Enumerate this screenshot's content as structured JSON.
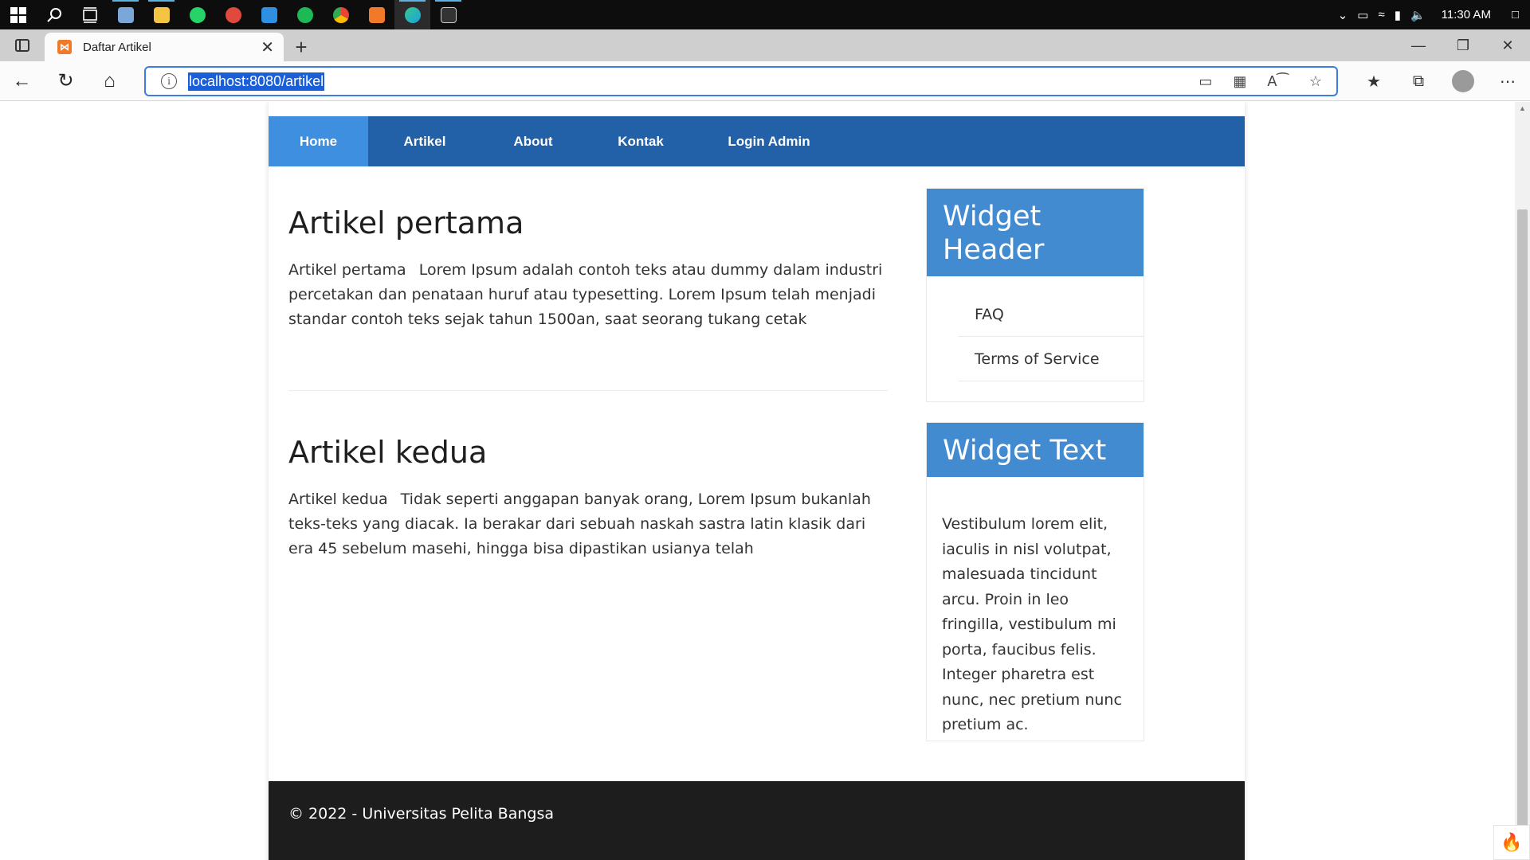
{
  "taskbar": {
    "apps": [
      {
        "name": "windows-start-icon",
        "color": "#ffffff",
        "active": false
      },
      {
        "name": "search-icon",
        "color": "#ffffff",
        "active": false
      },
      {
        "name": "task-view-icon",
        "color": "#ffffff",
        "active": false
      },
      {
        "name": "photos-app-icon",
        "color": "#7aa7d8",
        "active": true
      },
      {
        "name": "file-explorer-icon",
        "color": "#f4c542",
        "active": true
      },
      {
        "name": "whatsapp-icon",
        "color": "#25d366",
        "active": false
      },
      {
        "name": "weather-app-icon",
        "color": "#e04a3c",
        "active": false
      },
      {
        "name": "vscode-icon",
        "color": "#2f8fe0",
        "active": false
      },
      {
        "name": "spotify-icon",
        "color": "#1db954",
        "active": false
      },
      {
        "name": "chrome-icon",
        "color": "#f2b705",
        "active": false
      },
      {
        "name": "xampp-icon",
        "color": "#f07a2a",
        "active": false
      },
      {
        "name": "edge-icon",
        "color": "#1ba1e2",
        "active": true
      },
      {
        "name": "terminal-icon",
        "color": "#cccccc",
        "active": true
      }
    ],
    "clock": "11:30 AM"
  },
  "browser": {
    "tab_title": "Daftar Artikel",
    "url": "localhost:8080/artikel"
  },
  "page": {
    "nav": [
      {
        "label": "Home",
        "active": true
      },
      {
        "label": "Artikel",
        "active": false
      },
      {
        "label": "About",
        "active": false
      },
      {
        "label": "Kontak",
        "active": false
      },
      {
        "label": "Login Admin",
        "active": false
      }
    ],
    "articles": [
      {
        "title": "Artikel pertama",
        "image_alt": "Artikel pertama",
        "body": "Lorem Ipsum adalah contoh teks atau dummy dalam industri percetakan dan penataan huruf atau typesetting. Lorem Ipsum telah menjadi standar contoh teks sejak tahun 1500an, saat seorang tukang cetak"
      },
      {
        "title": "Artikel kedua",
        "image_alt": "Artikel kedua",
        "body": "Tidak seperti anggapan banyak orang, Lorem Ipsum bukanlah teks-teks yang diacak. Ia berakar dari sebuah naskah sastra latin klasik dari era 45 sebelum masehi, hingga bisa dipastikan usianya telah"
      }
    ],
    "widget_header": {
      "title": "Widget Header",
      "items": [
        "FAQ",
        "Terms of Service"
      ]
    },
    "widget_text": {
      "title": "Widget Text",
      "body": "Vestibulum lorem elit, iaculis in nisl volutpat, malesuada tincidunt arcu. Proin in leo fringilla, vestibulum mi porta, faucibus felis. Integer pharetra est nunc, nec pretium nunc pretium ac."
    },
    "footer": "© 2022 - Universitas Pelita Bangsa"
  },
  "colors": {
    "nav_bg": "#2260a8",
    "nav_active": "#3e8fe0",
    "widget_header_bg": "#428bd1",
    "footer_bg": "#1d1d1d"
  }
}
